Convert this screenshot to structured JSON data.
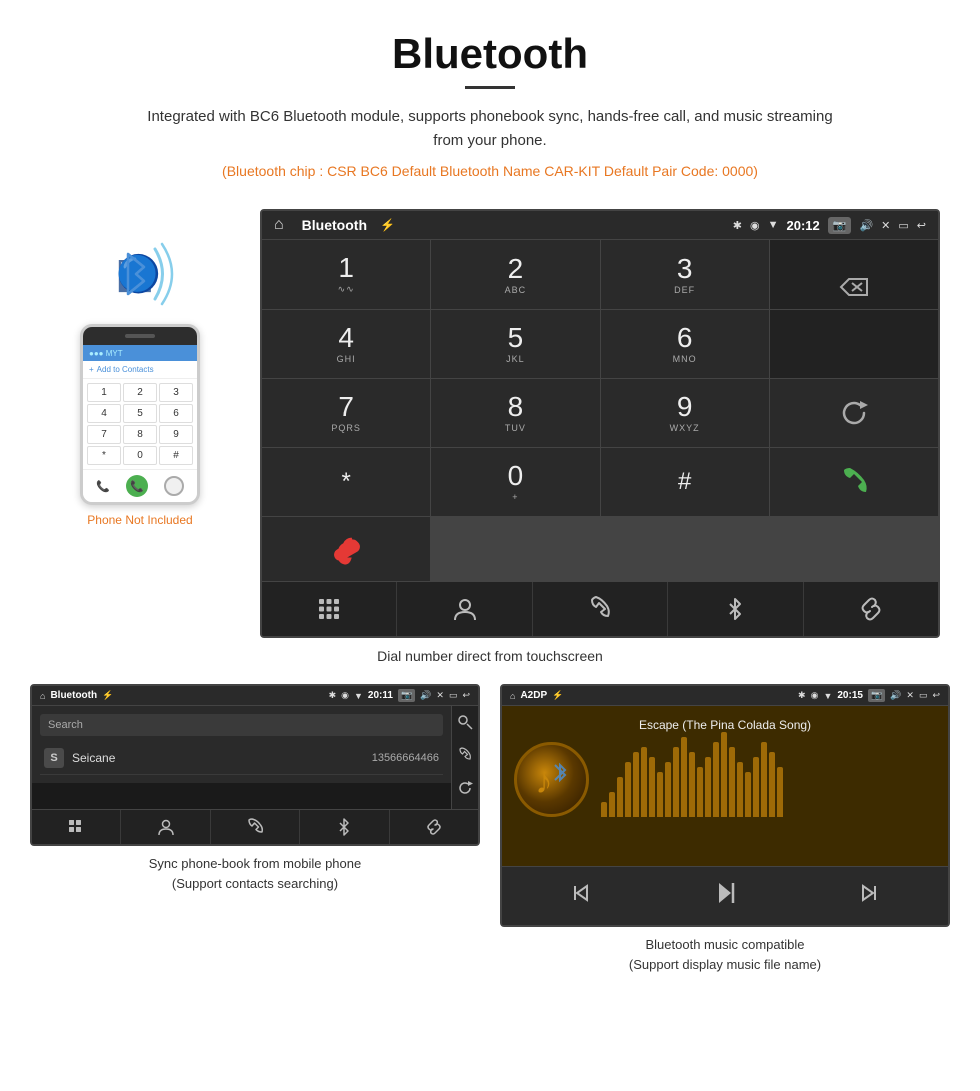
{
  "page": {
    "title": "Bluetooth",
    "subtitle": "Integrated with BC6 Bluetooth module, supports phonebook sync, hands-free call, and music streaming from your phone.",
    "specs": "(Bluetooth chip : CSR BC6    Default Bluetooth Name CAR-KIT    Default Pair Code: 0000)",
    "dialpad_caption": "Dial number direct from touchscreen",
    "phonebook_caption": "Sync phone-book from mobile phone\n(Support contacts searching)",
    "music_caption": "Bluetooth music compatible\n(Support display music file name)"
  },
  "status_bar": {
    "title": "Bluetooth",
    "time": "20:12",
    "home_icon": "⌂",
    "usb_icon": "⚡"
  },
  "dialpad": {
    "keys": [
      {
        "main": "1",
        "sub": "∿∿"
      },
      {
        "main": "2",
        "sub": "ABC"
      },
      {
        "main": "3",
        "sub": "DEF"
      },
      {
        "main": "4",
        "sub": "GHI"
      },
      {
        "main": "5",
        "sub": "JKL"
      },
      {
        "main": "6",
        "sub": "MNO"
      },
      {
        "main": "7",
        "sub": "PQRS"
      },
      {
        "main": "8",
        "sub": "TUV"
      },
      {
        "main": "9",
        "sub": "WXYZ"
      },
      {
        "main": "*",
        "sub": ""
      },
      {
        "main": "0",
        "sub": "+"
      },
      {
        "main": "#",
        "sub": ""
      }
    ]
  },
  "func_bar": {
    "icons": [
      "⋮⋮⋮",
      "👤",
      "📞",
      "✱",
      "🔗"
    ]
  },
  "phone_label": "Phone Not Included",
  "small_status_left": "Bluetooth",
  "small_status_time_1": "20:11",
  "small_status_time_2": "20:15",
  "a2dp_title": "A2DP",
  "song_title": "Escape (The Pina Colada Song)",
  "phonebook": {
    "search_placeholder": "Search",
    "contact_letter": "S",
    "contact_name": "Seicane",
    "contact_number": "13566664466"
  },
  "waveform_heights": [
    15,
    25,
    40,
    55,
    65,
    70,
    60,
    45,
    55,
    70,
    80,
    65,
    50,
    60,
    75,
    85,
    70,
    55,
    45,
    60,
    75,
    65,
    50
  ]
}
